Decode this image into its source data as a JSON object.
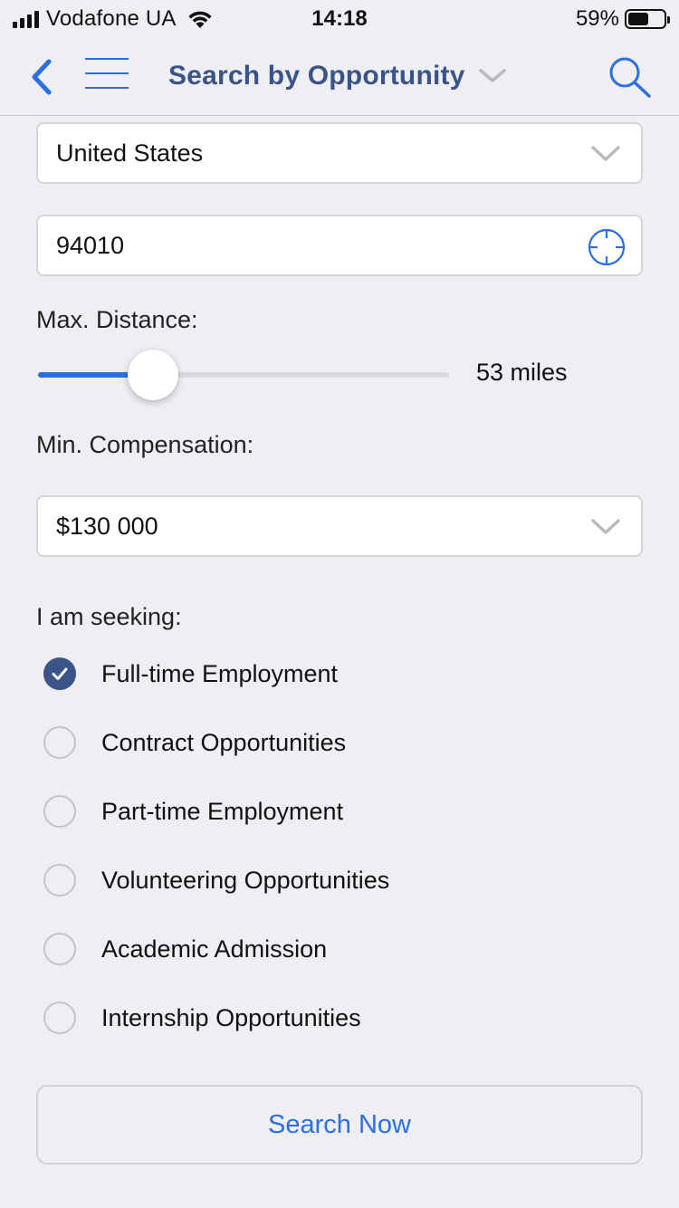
{
  "status_bar": {
    "carrier": "Vodafone UA",
    "time": "14:18",
    "battery_percent": "59%",
    "battery_level": 0.59
  },
  "nav": {
    "title": "Search by Opportunity",
    "icons": [
      "back-chevron-icon",
      "hamburger-menu-icon",
      "chevron-down-icon",
      "search-icon"
    ]
  },
  "form": {
    "country": {
      "value": "United States"
    },
    "zip": {
      "value": "94010"
    },
    "distance": {
      "label": "Max. Distance:",
      "value_text": "53 miles",
      "fraction": 0.28
    },
    "compensation": {
      "label": "Min. Compensation:",
      "value": "$130 000"
    },
    "seeking": {
      "label": "I am seeking:",
      "options": [
        {
          "label": "Full-time Employment",
          "checked": true
        },
        {
          "label": "Contract Opportunities",
          "checked": false
        },
        {
          "label": "Part-time Employment",
          "checked": false
        },
        {
          "label": "Volunteering Opportunities",
          "checked": false
        },
        {
          "label": "Academic Admission",
          "checked": false
        },
        {
          "label": "Internship Opportunities",
          "checked": false
        }
      ]
    },
    "submit_label": "Search Now"
  },
  "colors": {
    "accent": "#2b6fe0",
    "title": "#3a5488",
    "background": "#eeeef3"
  }
}
